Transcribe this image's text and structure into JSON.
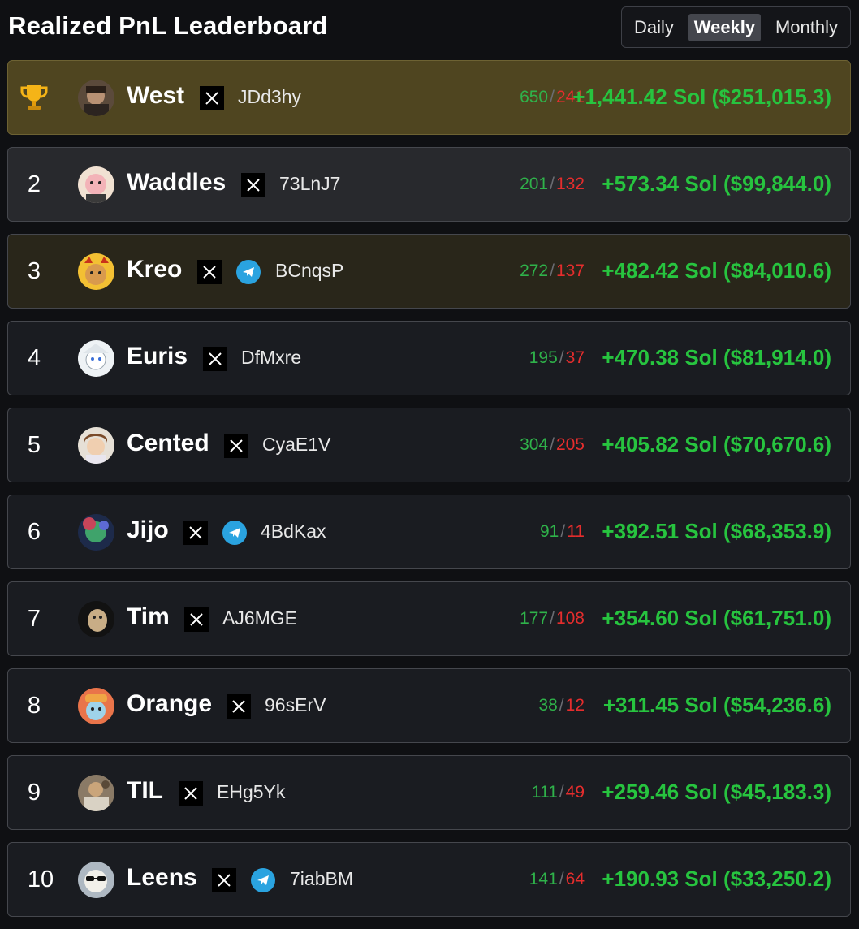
{
  "page": {
    "title": "Realized PnL Leaderboard"
  },
  "range_tabs": [
    {
      "label": "Daily",
      "active": false
    },
    {
      "label": "Weekly",
      "active": true
    },
    {
      "label": "Monthly",
      "active": false
    }
  ],
  "rows": [
    {
      "rank": "",
      "rank_icon": "trophy-icon",
      "name": "West",
      "x_link": true,
      "telegram": false,
      "wallet": "JDd3hy",
      "wins": "650",
      "losses": "241",
      "pnl": "+1,441.42 Sol ($251,015.3)"
    },
    {
      "rank": "2",
      "name": "Waddles",
      "x_link": true,
      "telegram": false,
      "wallet": "73LnJ7",
      "wins": "201",
      "losses": "132",
      "pnl": "+573.34 Sol ($99,844.0)"
    },
    {
      "rank": "3",
      "name": "Kreo",
      "x_link": true,
      "telegram": true,
      "wallet": "BCnqsP",
      "wins": "272",
      "losses": "137",
      "pnl": "+482.42 Sol ($84,010.6)"
    },
    {
      "rank": "4",
      "name": "Euris",
      "x_link": true,
      "telegram": false,
      "wallet": "DfMxre",
      "wins": "195",
      "losses": "37",
      "pnl": "+470.38 Sol ($81,914.0)"
    },
    {
      "rank": "5",
      "name": "Cented",
      "x_link": true,
      "telegram": false,
      "wallet": "CyaE1V",
      "wins": "304",
      "losses": "205",
      "pnl": "+405.82 Sol ($70,670.6)"
    },
    {
      "rank": "6",
      "name": "Jijo",
      "x_link": true,
      "telegram": true,
      "wallet": "4BdKax",
      "wins": "91",
      "losses": "11",
      "pnl": "+392.51 Sol ($68,353.9)"
    },
    {
      "rank": "7",
      "name": "Tim",
      "x_link": true,
      "telegram": false,
      "wallet": "AJ6MGE",
      "wins": "177",
      "losses": "108",
      "pnl": "+354.60 Sol ($61,751.0)"
    },
    {
      "rank": "8",
      "name": "Orange",
      "x_link": true,
      "telegram": false,
      "wallet": "96sErV",
      "wins": "38",
      "losses": "12",
      "pnl": "+311.45 Sol ($54,236.6)"
    },
    {
      "rank": "9",
      "name": "TIL",
      "x_link": true,
      "telegram": false,
      "wallet": "EHg5Yk",
      "wins": "111",
      "losses": "49",
      "pnl": "+259.46 Sol ($45,183.3)"
    },
    {
      "rank": "10",
      "name": "Leens",
      "x_link": true,
      "telegram": true,
      "wallet": "7iabBM",
      "wins": "141",
      "losses": "64",
      "pnl": "+190.93 Sol ($33,250.2)"
    }
  ],
  "colors": {
    "win": "#2fb24a",
    "loss": "#e52d2d",
    "pnl": "#27c43f",
    "gold_row": "#4f4520",
    "telegram": "#2aa3e0"
  }
}
